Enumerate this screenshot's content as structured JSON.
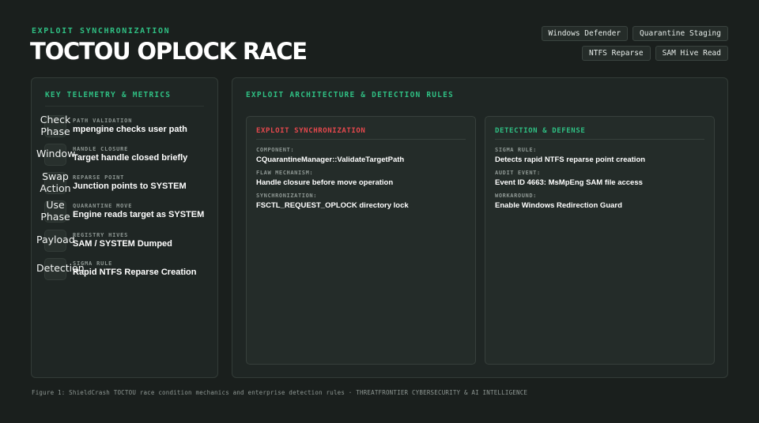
{
  "header": {
    "eyebrow": "EXPLOIT SYNCHRONIZATION",
    "title": "TOCTOU OPLOCK RACE",
    "tags": [
      "Windows Defender",
      "Quarantine Staging",
      "NTFS Reparse",
      "SAM Hive Read"
    ]
  },
  "metrics_panel": {
    "heading": "KEY TELEMETRY & METRICS",
    "items": [
      {
        "icon": "Check\nPhase",
        "label": "PATH VALIDATION",
        "value": "mpengine checks user path"
      },
      {
        "icon": "Window",
        "label": "HANDLE CLOSURE",
        "value": "Target handle closed briefly"
      },
      {
        "icon": "Swap\nAction",
        "label": "REPARSE POINT",
        "value": "Junction points to SYSTEM"
      },
      {
        "icon": "Use\nPhase",
        "label": "QUARANTINE MOVE",
        "value": "Engine reads target as SYSTEM"
      },
      {
        "icon": "Payload",
        "label": "REGISTRY HIVES",
        "value": "SAM / SYSTEM Dumped"
      },
      {
        "icon": "Detection",
        "label": "SIGMA RULE",
        "value": "Rapid NTFS Reparse Creation"
      }
    ]
  },
  "architecture_panel": {
    "heading": "EXPLOIT ARCHITECTURE & DETECTION RULES",
    "exploit_card": {
      "heading": "EXPLOIT SYNCHRONIZATION",
      "color": "#e5484d",
      "entries": [
        {
          "label": "COMPONENT:",
          "value": "CQuarantineManager::ValidateTargetPath"
        },
        {
          "label": "FLAW MECHANISM:",
          "value": "Handle closure before move operation"
        },
        {
          "label": "SYNCHRONIZATION:",
          "value": "FSCTL_REQUEST_OPLOCK directory lock"
        }
      ]
    },
    "defense_card": {
      "heading": "DETECTION & DEFENSE",
      "color": "#2fbf83",
      "entries": [
        {
          "label": "SIGMA RULE:",
          "value": "Detects rapid NTFS reparse point creation"
        },
        {
          "label": "AUDIT EVENT:",
          "value": "Event ID 4663: MsMpEng SAM file access"
        },
        {
          "label": "WORKAROUND:",
          "value": "Enable Windows Redirection Guard"
        }
      ]
    }
  },
  "caption": "Figure 1: ShieldCrash TOCTOU race condition mechanics and enterprise detection rules · THREATFRONTIER CYBERSECURITY & AI INTELLIGENCE"
}
